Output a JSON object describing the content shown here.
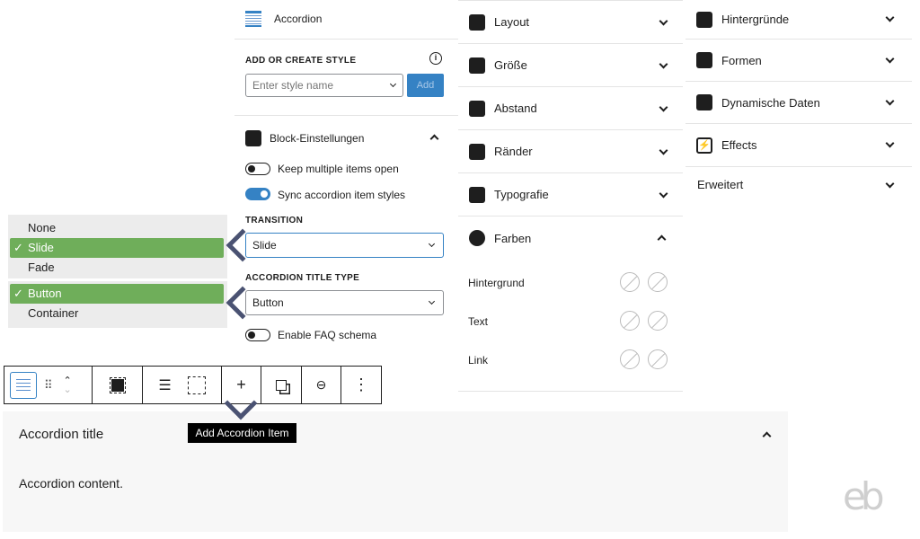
{
  "block": {
    "title": "Accordion",
    "icon": "accordion-icon"
  },
  "style": {
    "label": "ADD OR CREATE STYLE",
    "placeholder": "Enter style name",
    "add": "Add",
    "info_icon": "info-icon"
  },
  "settings": {
    "title": "Block-Einstellungen",
    "keep_open": "Keep multiple items open",
    "keep_open_on": false,
    "sync": "Sync accordion item styles",
    "sync_on": true,
    "transition_label": "TRANSITION",
    "transition_value": "Slide",
    "title_type_label": "ACCORDION TITLE TYPE",
    "title_type_value": "Button",
    "faq": "Enable FAQ schema",
    "faq_on": false
  },
  "dropdown_transition": {
    "options": [
      "None",
      "Slide",
      "Fade"
    ],
    "selected": "Slide"
  },
  "dropdown_title_type": {
    "options": [
      "Button",
      "Container"
    ],
    "selected": "Button"
  },
  "panels_mid": [
    {
      "label": "Layout"
    },
    {
      "label": "Größe"
    },
    {
      "label": "Abstand"
    },
    {
      "label": "Ränder"
    },
    {
      "label": "Typografie"
    },
    {
      "label": "Farben"
    }
  ],
  "colors": [
    {
      "label": "Hintergrund"
    },
    {
      "label": "Text"
    },
    {
      "label": "Link"
    }
  ],
  "panels_right": [
    {
      "label": "Hintergründe"
    },
    {
      "label": "Formen"
    },
    {
      "label": "Dynamische Daten"
    },
    {
      "label": "Effects"
    },
    {
      "label": "Erweitert"
    }
  ],
  "toolbar": {
    "tooltip": "Add Accordion Item",
    "plus": "+",
    "more": "⋮"
  },
  "preview": {
    "title": "Accordion title",
    "content": "Accordion content."
  },
  "logo": "eb",
  "colors_theme": {
    "accent": "#3582c4",
    "selected_option": "#6fae5a",
    "arrow": "#4a5272"
  }
}
